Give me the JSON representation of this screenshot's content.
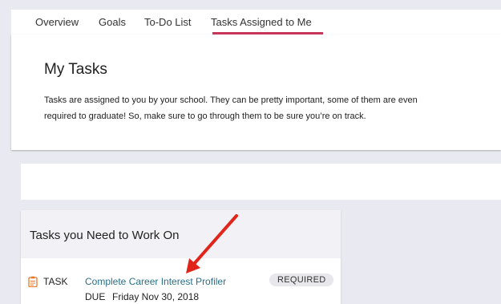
{
  "tabs": [
    {
      "label": "Overview"
    },
    {
      "label": "Goals"
    },
    {
      "label": "To-Do List"
    },
    {
      "label": "Tasks Assigned to Me",
      "active": true
    }
  ],
  "intro": {
    "title": "My Tasks",
    "description": "Tasks are assigned to you by your school. They can be pretty important, some of them are even required to graduate! So, make sure to go through them to be sure you’re on track."
  },
  "tasks_section": {
    "title": "Tasks you Need to Work On",
    "items": [
      {
        "icon": "clipboard-icon",
        "type": "TASK",
        "name": "Complete Career Interest Profiler",
        "badge": "REQUIRED",
        "due_label": "DUE",
        "due_date": "Friday Nov 30, 2018"
      }
    ]
  },
  "annotation": {
    "icon": "red-arrow"
  },
  "colors": {
    "accent": "#c8365b",
    "link": "#2a6f88",
    "arrow": "#e1251b",
    "task_icon": "#e8782a",
    "background": "#e9eaf1"
  }
}
